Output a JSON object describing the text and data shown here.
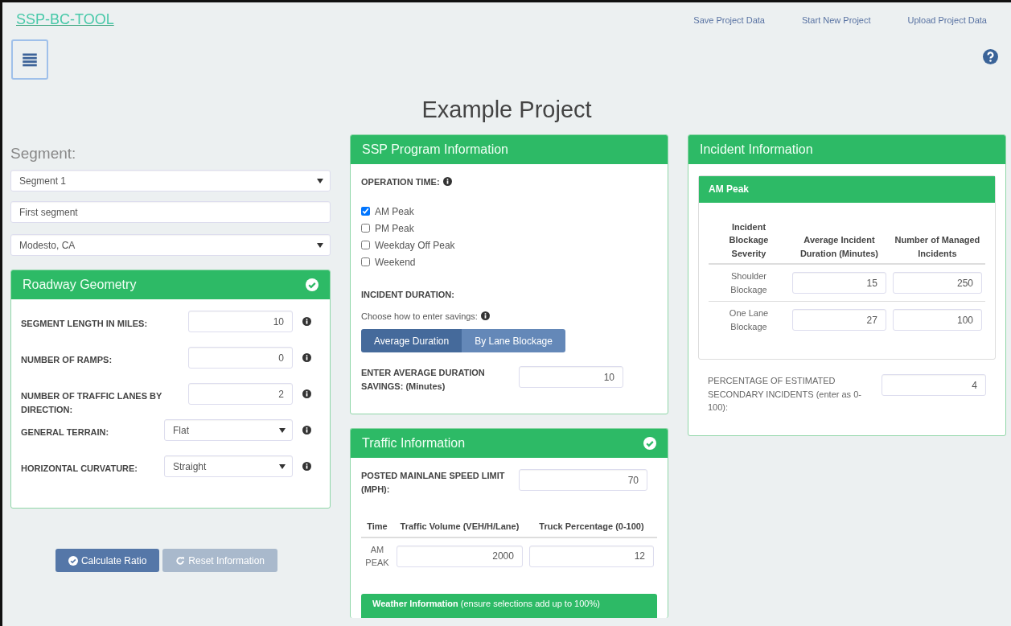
{
  "app": {
    "brand": "SSP-BC-TOOL",
    "links": [
      "Save Project Data",
      "Start New Project",
      "Upload Project Data"
    ]
  },
  "project_title": "Example Project",
  "segment": {
    "label": "Segment:",
    "selected_segment": "Segment 1",
    "name": "First segment",
    "location": "Modesto, CA"
  },
  "roadway": {
    "title": "Roadway Geometry",
    "complete": true,
    "fields": [
      {
        "label": "SEGMENT LENGTH IN MILES:",
        "value": "10",
        "kind": "input"
      },
      {
        "label": "NUMBER OF RAMPS:",
        "value": "0",
        "kind": "input"
      },
      {
        "label": "NUMBER OF TRAFFIC LANES BY DIRECTION:",
        "value": "2",
        "kind": "input"
      },
      {
        "label": "GENERAL TERRAIN:",
        "value": "Flat",
        "kind": "select"
      },
      {
        "label": "HORIZONTAL CURVATURE:",
        "value": "Straight",
        "kind": "select"
      }
    ]
  },
  "buttons": [
    {
      "label": "Calculate Ratio",
      "kind": "calculate",
      "disabled": false
    },
    {
      "label": "Reset Information",
      "kind": "reset",
      "disabled": true
    }
  ],
  "ssp": {
    "title": "SSP Program Information",
    "operation_label": "OPERATION TIME:",
    "operation_times": [
      {
        "label": "AM Peak",
        "checked": true
      },
      {
        "label": "PM Peak",
        "checked": false
      },
      {
        "label": "Weekday Off Peak",
        "checked": false
      },
      {
        "label": "Weekend",
        "checked": false
      }
    ],
    "duration_label": "INCIDENT DURATION:",
    "choose_text": "Choose how to enter savings:",
    "modes": [
      {
        "label": "Average Duration",
        "selected": true
      },
      {
        "label": "By Lane Blockage",
        "selected": false
      }
    ],
    "savings_label": "ENTER AVERAGE DURATION SAVINGS: (Minutes)",
    "savings_value": "10"
  },
  "traffic": {
    "title": "Traffic Information",
    "complete": true,
    "speed_label": "POSTED MAINLANE SPEED LIMIT (MPH):",
    "speed_value": "70",
    "columns": [
      "Time",
      "Traffic Volume (VEH/H/Lane)",
      "Truck Percentage (0-100)"
    ],
    "rows": [
      {
        "time": "AM PEAK",
        "volume": "2000",
        "truck": "12"
      }
    ],
    "weather_note": "**Weather Information** (ensure selections add up to 100%)"
  },
  "incident": {
    "title": "Incident Information",
    "period": "AM Peak",
    "columns": [
      "Incident Blockage Severity",
      "Average Incident Duration (Minutes)",
      "Number of Managed Incidents"
    ],
    "rows": [
      {
        "severity": "Shoulder Blockage",
        "duration": "15",
        "count": "250"
      },
      {
        "severity": "One Lane Blockage",
        "duration": "27",
        "count": "100"
      }
    ],
    "secondary_label": "PERCENTAGE OF ESTIMATED SECONDARY INCIDENTS (enter as 0-100):",
    "secondary_value": "4"
  }
}
